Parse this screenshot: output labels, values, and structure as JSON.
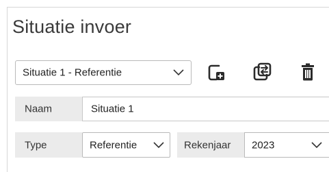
{
  "title": "Situatie invoer",
  "situation_select": {
    "value": "Situatie 1 - Referentie"
  },
  "toolbar": {
    "icons": [
      "add-situation-icon",
      "copy-situation-icon",
      "delete-icon"
    ]
  },
  "form": {
    "naam": {
      "label": "Naam",
      "value": "Situatie 1"
    },
    "type": {
      "label": "Type",
      "value": "Referentie"
    },
    "rekenjaar": {
      "label": "Rekenjaar",
      "value": "2023"
    }
  }
}
